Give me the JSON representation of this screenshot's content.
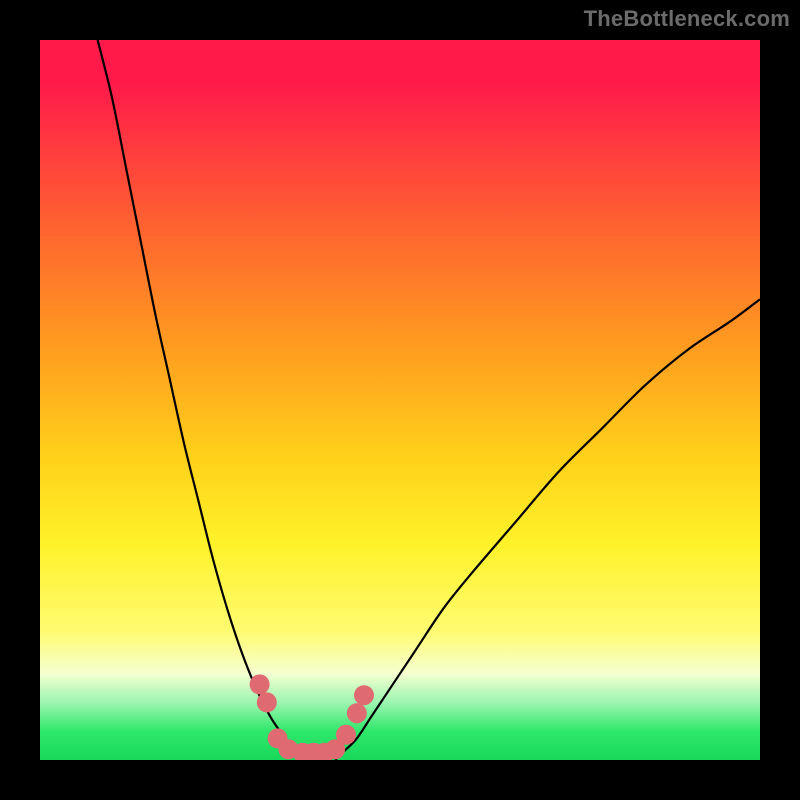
{
  "watermark": "TheBottleneck.com",
  "chart_data": {
    "type": "line",
    "xlim": [
      0,
      100
    ],
    "ylim": [
      0,
      100
    ],
    "title": "",
    "xlabel": "",
    "ylabel": "",
    "grid": false,
    "legend": null,
    "series": [
      {
        "name": "left-curve",
        "x": [
          8,
          10,
          12,
          14,
          16,
          18,
          20,
          22,
          24,
          26,
          28,
          30,
          32,
          34,
          35,
          36
        ],
        "y": [
          100,
          92,
          82,
          72,
          62,
          53,
          44,
          36,
          28,
          21,
          15,
          10,
          6,
          3,
          1,
          0
        ]
      },
      {
        "name": "right-curve",
        "x": [
          41,
          42,
          44,
          46,
          48,
          52,
          56,
          60,
          66,
          72,
          78,
          84,
          90,
          96,
          100
        ],
        "y": [
          0,
          1,
          3,
          6,
          9,
          15,
          21,
          26,
          33,
          40,
          46,
          52,
          57,
          61,
          64
        ]
      }
    ],
    "scatter": {
      "name": "dots",
      "color": "#e06a72",
      "points": [
        {
          "x": 30.5,
          "y": 10.5
        },
        {
          "x": 31.5,
          "y": 8.0
        },
        {
          "x": 33.0,
          "y": 3.0
        },
        {
          "x": 34.5,
          "y": 1.5
        },
        {
          "x": 36.5,
          "y": 1.0
        },
        {
          "x": 38.0,
          "y": 1.0
        },
        {
          "x": 39.5,
          "y": 1.0
        },
        {
          "x": 41.0,
          "y": 1.5
        },
        {
          "x": 42.5,
          "y": 3.5
        },
        {
          "x": 44.0,
          "y": 6.5
        },
        {
          "x": 45.0,
          "y": 9.0
        }
      ]
    }
  }
}
